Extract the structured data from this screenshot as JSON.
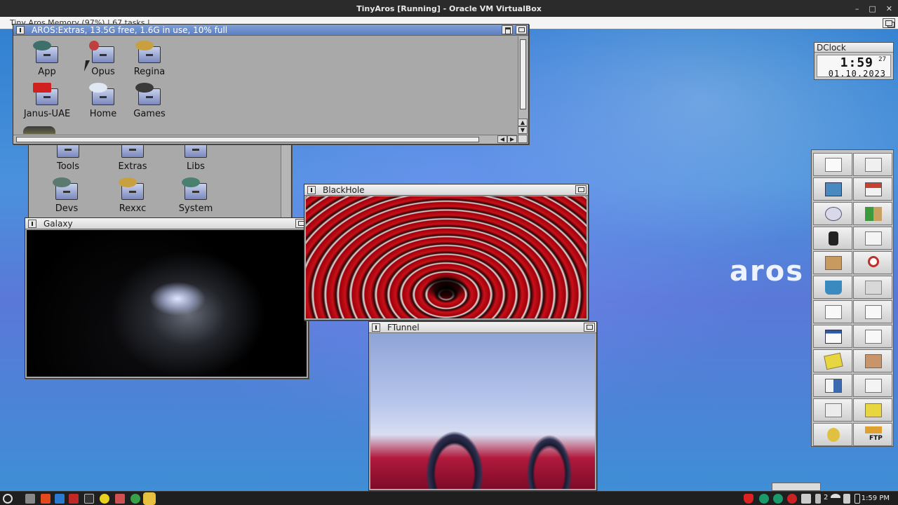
{
  "host": {
    "title": "TinyAros [Running] - Oracle VM VirtualBox",
    "controls": {
      "minimize": "–",
      "maximize": "□",
      "close": "✕"
    }
  },
  "screen": {
    "title": "Tiny Aros Memory (97%) | 67 tasks |"
  },
  "desktop": {
    "logo_text": "aros"
  },
  "extras_window": {
    "title": "AROS:Extras, 13.5G free, 1.6G in use, 10% full",
    "icons": [
      {
        "label": "App"
      },
      {
        "label": "Opus"
      },
      {
        "label": "Regina"
      },
      {
        "label": "Janus-UAE"
      },
      {
        "label": "Home"
      },
      {
        "label": "Games"
      }
    ]
  },
  "sys_window": {
    "icons": [
      {
        "label": "Tools"
      },
      {
        "label": "Extras"
      },
      {
        "label": "Libs"
      },
      {
        "label": "Devs"
      },
      {
        "label": "Rexxc"
      },
      {
        "label": "System"
      }
    ]
  },
  "galaxy_window": {
    "title": "Galaxy"
  },
  "blackhole_window": {
    "title": "BlackHole"
  },
  "ftunnel_window": {
    "title": "FTunnel"
  },
  "dclock": {
    "title": "DClock",
    "time": "1:59",
    "seconds": "27",
    "date": "01.10.2023"
  },
  "dock": {
    "items": [
      "window-icon",
      "window-icon",
      "disk-icon",
      "home-icon",
      "prefs-icon",
      "arrow-icon",
      "run-icon",
      "file-icon",
      "folder-icon",
      "search-icon",
      "trash-icon",
      "box-icon",
      "note-icon",
      "window-icon",
      "calendar-icon",
      "window-icon",
      "notepad-icon",
      "package-icon",
      "storage-icon",
      "file-icon",
      "print-icon",
      "folder-icon",
      "user-icon",
      "ftp-icon"
    ],
    "ftp_label": "FTP"
  },
  "taskbar": {
    "clock": "1:59 PM",
    "battery_text": "2"
  },
  "colors": {
    "desktop_blue": "#4a91dc",
    "title_active": "#5b7fc3"
  }
}
